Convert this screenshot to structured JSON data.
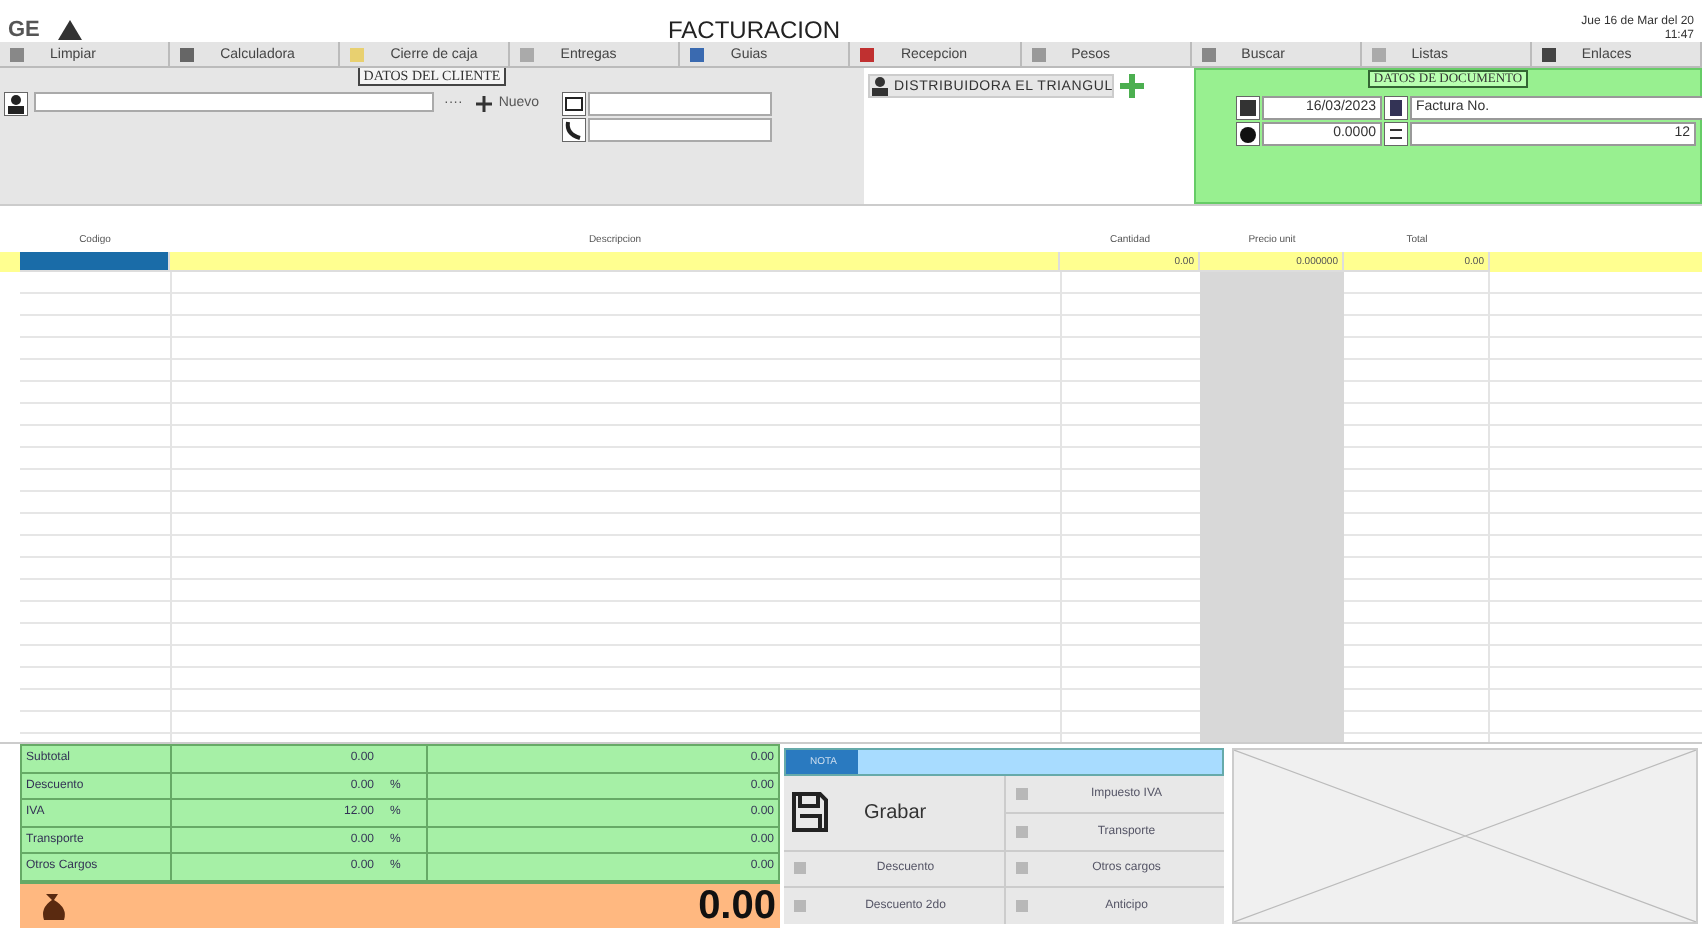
{
  "header": {
    "logo": "GE",
    "title": "FACTURACION",
    "date": "Jue 16 de Mar del 20",
    "time": "11:47"
  },
  "toolbar": [
    {
      "label": "Limpiar"
    },
    {
      "label": "Calculadora"
    },
    {
      "label": "Cierre de caja"
    },
    {
      "label": "Entregas"
    },
    {
      "label": "Guias"
    },
    {
      "label": "Recepcion"
    },
    {
      "label": "Pesos"
    },
    {
      "label": "Buscar"
    },
    {
      "label": "Listas"
    },
    {
      "label": "Enlaces"
    }
  ],
  "client": {
    "title": "DATOS DEL CLIENTE",
    "search_button": "····",
    "new_button": "Nuevo",
    "distributor": "DISTRIBUIDORA EL TRIANGUL"
  },
  "document": {
    "title": "DATOS DE DOCUMENTO",
    "date": "16/03/2023",
    "doc_type": "Factura No.",
    "rate": "0.0000",
    "number": "12"
  },
  "table": {
    "columns": [
      "Codigo",
      "Descripcion",
      "Cantidad",
      "Precio unit",
      "Total"
    ],
    "rows": [
      {
        "selected": true,
        "cells": [
          "",
          "",
          "0.00",
          "0.000000",
          "0.00"
        ]
      }
    ]
  },
  "totals": [
    {
      "label": "Subtotal",
      "rate": "0.00",
      "percent": false,
      "amount": "0.00"
    },
    {
      "label": "Descuento",
      "rate": "0.00",
      "percent": true,
      "amount": "0.00"
    },
    {
      "label": "IVA",
      "rate": "12.00",
      "percent": true,
      "amount": "0.00"
    },
    {
      "label": "Transporte",
      "rate": "0.00",
      "percent": true,
      "amount": "0.00"
    },
    {
      "label": "Otros Cargos",
      "rate": "0.00",
      "percent": true,
      "amount": "0.00"
    }
  ],
  "percent_sign": "%",
  "grand_total": "0.00",
  "note": {
    "title": "NOTA",
    "save": "Grabar",
    "actions": [
      "Impuesto IVA",
      "Transporte",
      "Descuento",
      "Otros cargos",
      "Descuento 2do",
      "Anticipo"
    ]
  }
}
